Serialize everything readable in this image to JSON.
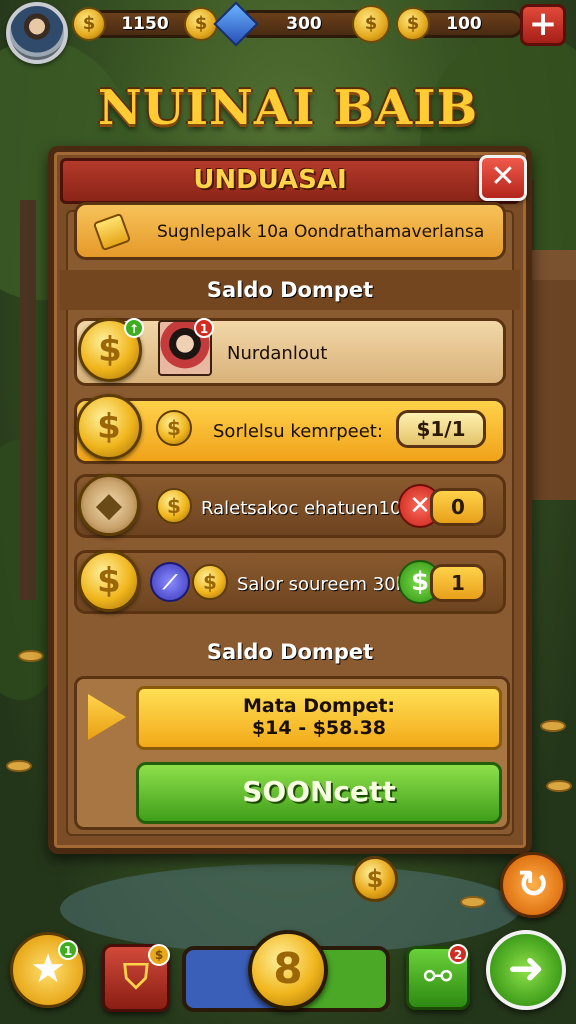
{
  "hud": {
    "coin_count": "1150",
    "gem_count": "300",
    "cash_count": "100",
    "coin_symbol": "$",
    "add_symbol": "+"
  },
  "game_title": "NUINAI BAIB",
  "dialog": {
    "title": "UNDUASAI",
    "close_symbol": "✕",
    "info_text": "Sugnlepalk 10a Oondrathamaverlansa",
    "section1_label": "Saldo Dompet",
    "rows": [
      {
        "label": "Nurdanlout",
        "badge": "1"
      },
      {
        "label": "Sorlelsu kemrpeet:",
        "value": "$1/1"
      },
      {
        "label": "Raletsakoc ehatuen10a1",
        "value": "0"
      },
      {
        "label": "Salor soureem 30l",
        "value": "1"
      }
    ],
    "section2_label": "Saldo Dompet",
    "wallet_label": "Mata Dompet:",
    "wallet_range": "$14 - $58.38",
    "action_button": "SOONcett"
  },
  "bottom": {
    "star_badge": "1",
    "shop_badge": "$",
    "link_badge": "2",
    "center_coin": "8"
  },
  "colors": {
    "accent_gold": "#ffcc33",
    "header_red": "#b43a2b",
    "action_green": "#3f9e1a"
  },
  "icons": [
    "avatar",
    "coin-icon",
    "gem-icon",
    "plus-icon",
    "close-icon",
    "tag-icon",
    "ticket-icon",
    "magic-wand-icon",
    "dollar-icon",
    "play-icon",
    "star-icon",
    "shop-icon",
    "link-icon",
    "refresh-icon",
    "next-arrow-icon"
  ]
}
